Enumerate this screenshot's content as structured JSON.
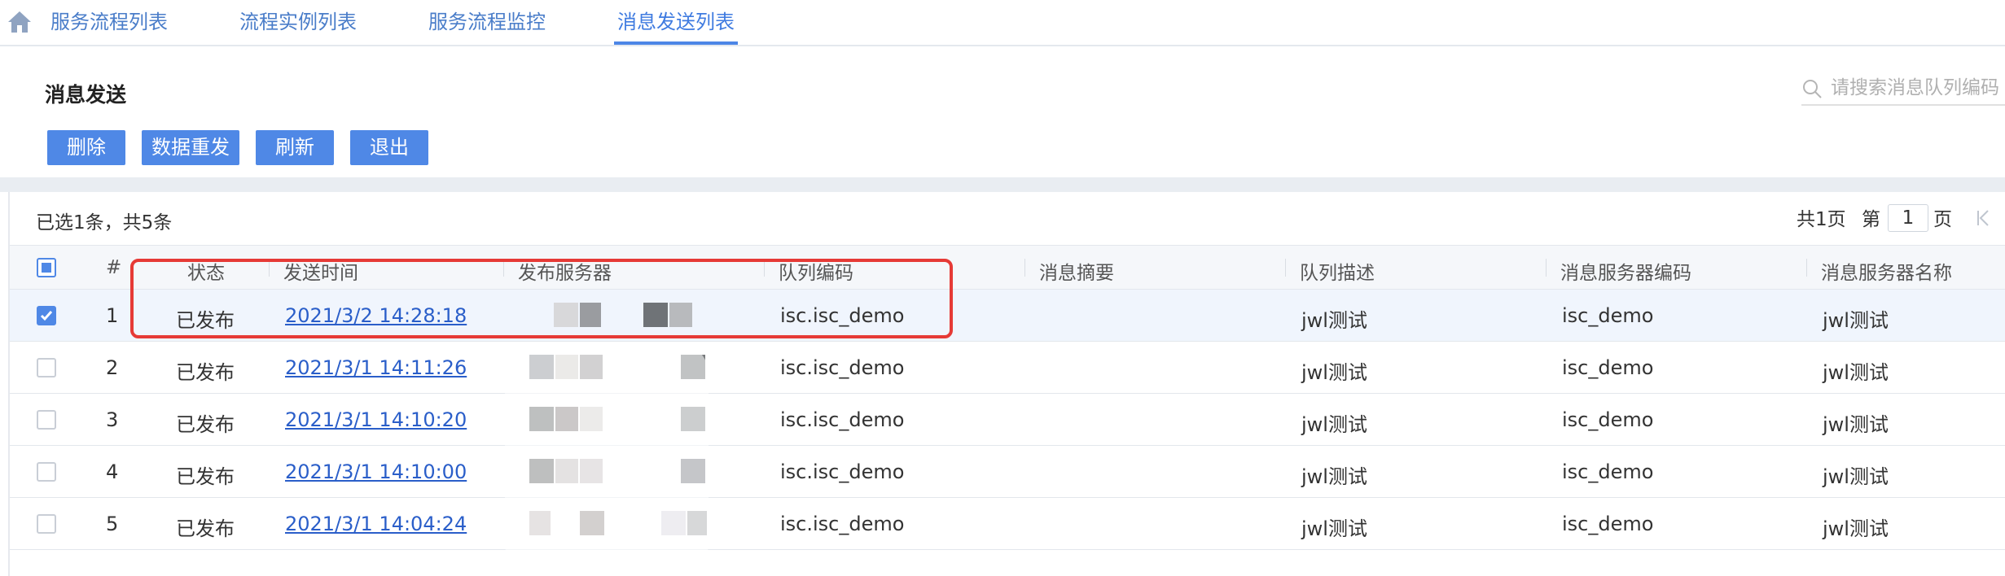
{
  "tabs": [
    {
      "label": "服务流程列表",
      "active": false
    },
    {
      "label": "流程实例列表",
      "active": false
    },
    {
      "label": "服务流程监控",
      "active": false
    },
    {
      "label": "消息发送列表",
      "active": true
    }
  ],
  "icons": {
    "home": "home-icon",
    "search": "search-icon",
    "first_page": "first-page-icon"
  },
  "header": {
    "title": "消息发送",
    "search_placeholder": "请搜索消息队列编码"
  },
  "toolbar": {
    "delete_label": "删除",
    "resend_label": "数据重发",
    "refresh_label": "刷新",
    "exit_label": "退出"
  },
  "table": {
    "selected_info": "已选1条，共5条",
    "pager": {
      "total_pages": "共1页",
      "page_prefix": "第",
      "current_page": "1",
      "page_suffix": "页"
    },
    "columns": [
      "#",
      "状态",
      "发送时间",
      "发布服务器",
      "队列编码",
      "消息摘要",
      "队列描述",
      "消息服务器编码",
      "消息服务器名称"
    ],
    "rows": [
      {
        "checked": true,
        "index": "1",
        "status": "已发布",
        "send_time": "2021/3/2 14:28:18",
        "queue_code": "isc.isc_demo",
        "summary": "",
        "queue_desc": "jwl测试",
        "server_code": "isc_demo",
        "server_name": "jwl测试"
      },
      {
        "checked": false,
        "index": "2",
        "status": "已发布",
        "send_time": "2021/3/1 14:11:26",
        "queue_code": "isc.isc_demo",
        "summary": "",
        "queue_desc": "jwl测试",
        "server_code": "isc_demo",
        "server_name": "jwl测试"
      },
      {
        "checked": false,
        "index": "3",
        "status": "已发布",
        "send_time": "2021/3/1 14:10:20",
        "queue_code": "isc.isc_demo",
        "summary": "",
        "queue_desc": "jwl测试",
        "server_code": "isc_demo",
        "server_name": "jwl测试"
      },
      {
        "checked": false,
        "index": "4",
        "status": "已发布",
        "send_time": "2021/3/1 14:10:00",
        "queue_code": "isc.isc_demo",
        "summary": "",
        "queue_desc": "jwl测试",
        "server_code": "isc_demo",
        "server_name": "jwl测试"
      },
      {
        "checked": false,
        "index": "5",
        "status": "已发布",
        "send_time": "2021/3/1 14:04:24",
        "queue_code": "isc.isc_demo",
        "summary": "",
        "queue_desc": "jwl测试",
        "server_code": "isc_demo",
        "server_name": "jwl测试"
      }
    ]
  },
  "colors": {
    "accent": "#4f88e6",
    "link": "#2a5ec9",
    "annotation": "#e63a36"
  }
}
